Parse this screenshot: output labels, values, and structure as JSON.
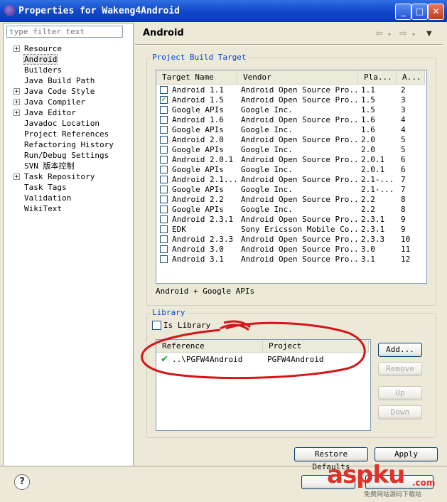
{
  "window": {
    "title": "Properties for Wakeng4Android",
    "minimize": "_",
    "maximize": "□",
    "close": "✕"
  },
  "filter": {
    "placeholder": "type filter text"
  },
  "tree": [
    {
      "label": "Resource",
      "expandable": true
    },
    {
      "label": "Android",
      "expandable": false,
      "selected": true
    },
    {
      "label": "Builders",
      "expandable": false
    },
    {
      "label": "Java Build Path",
      "expandable": false
    },
    {
      "label": "Java Code Style",
      "expandable": true
    },
    {
      "label": "Java Compiler",
      "expandable": true
    },
    {
      "label": "Java Editor",
      "expandable": true
    },
    {
      "label": "Javadoc Location",
      "expandable": false
    },
    {
      "label": "Project References",
      "expandable": false
    },
    {
      "label": "Refactoring History",
      "expandable": false
    },
    {
      "label": "Run/Debug Settings",
      "expandable": false
    },
    {
      "label": "SVN 版本控制",
      "expandable": false
    },
    {
      "label": "Task Repository",
      "expandable": true
    },
    {
      "label": "Task Tags",
      "expandable": false
    },
    {
      "label": "Validation",
      "expandable": false
    },
    {
      "label": "WikiText",
      "expandable": false
    }
  ],
  "page": {
    "title": "Android"
  },
  "build_target": {
    "group_label": "Project Build Target",
    "columns": [
      "Target Name",
      "Vendor",
      "Pla...",
      "A..."
    ],
    "rows": [
      {
        "checked": false,
        "name": "Android 1.1",
        "vendor": "Android Open Source Pro...",
        "platform": "1.1",
        "api": "2"
      },
      {
        "checked": true,
        "name": "Android 1.5",
        "vendor": "Android Open Source Pro...",
        "platform": "1.5",
        "api": "3"
      },
      {
        "checked": false,
        "name": "Google APIs",
        "vendor": "Google Inc.",
        "platform": "1.5",
        "api": "3"
      },
      {
        "checked": false,
        "name": "Android 1.6",
        "vendor": "Android Open Source Pro...",
        "platform": "1.6",
        "api": "4"
      },
      {
        "checked": false,
        "name": "Google APIs",
        "vendor": "Google Inc.",
        "platform": "1.6",
        "api": "4"
      },
      {
        "checked": false,
        "name": "Android 2.0",
        "vendor": "Android Open Source Pro...",
        "platform": "2.0",
        "api": "5"
      },
      {
        "checked": false,
        "name": "Google APIs",
        "vendor": "Google Inc.",
        "platform": "2.0",
        "api": "5"
      },
      {
        "checked": false,
        "name": "Android 2.0.1",
        "vendor": "Android Open Source Pro...",
        "platform": "2.0.1",
        "api": "6"
      },
      {
        "checked": false,
        "name": "Google APIs",
        "vendor": "Google Inc.",
        "platform": "2.0.1",
        "api": "6"
      },
      {
        "checked": false,
        "name": "Android 2.1...",
        "vendor": "Android Open Source Pro...",
        "platform": "2.1-...",
        "api": "7"
      },
      {
        "checked": false,
        "name": "Google APIs",
        "vendor": "Google Inc.",
        "platform": "2.1-...",
        "api": "7"
      },
      {
        "checked": false,
        "name": "Android 2.2",
        "vendor": "Android Open Source Pro...",
        "platform": "2.2",
        "api": "8"
      },
      {
        "checked": false,
        "name": "Google APIs",
        "vendor": "Google Inc.",
        "platform": "2.2",
        "api": "8"
      },
      {
        "checked": false,
        "name": "Android 2.3.1",
        "vendor": "Android Open Source Pro...",
        "platform": "2.3.1",
        "api": "9"
      },
      {
        "checked": false,
        "name": "EDK",
        "vendor": "Sony Ericsson Mobile Co...",
        "platform": "2.3.1",
        "api": "9"
      },
      {
        "checked": false,
        "name": "Android 2.3.3",
        "vendor": "Android Open Source Pro...",
        "platform": "2.3.3",
        "api": "10"
      },
      {
        "checked": false,
        "name": "Android 3.0",
        "vendor": "Android Open Source Pro...",
        "platform": "3.0",
        "api": "11"
      },
      {
        "checked": false,
        "name": "Android 3.1",
        "vendor": "Android Open Source Pro...",
        "platform": "3.1",
        "api": "12"
      }
    ],
    "description": "Android + Google APIs"
  },
  "library": {
    "group_label": "Library",
    "is_library_label": "Is Library",
    "is_library_checked": false,
    "columns": [
      "Reference",
      "Project"
    ],
    "rows": [
      {
        "reference": "..\\PGFW4Android",
        "project": "PGFW4Android"
      }
    ],
    "buttons": {
      "add": "Add...",
      "remove": "Remove",
      "up": "Up",
      "down": "Down"
    }
  },
  "footer": {
    "restore_defaults": "Restore Defaults",
    "apply": "Apply",
    "help": "?"
  },
  "watermark": {
    "main": "aspku",
    "sub": "免费网站源码下载站",
    "dot_com": ".com"
  },
  "colors": {
    "annotation": "#d4151a",
    "group_label": "#0046d5",
    "title_bar": "#1147c9"
  }
}
